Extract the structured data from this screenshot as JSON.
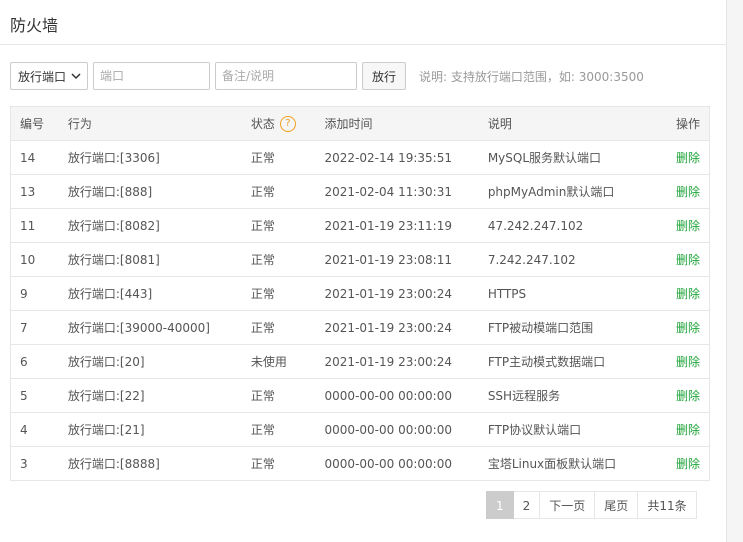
{
  "page": {
    "title": "防火墙"
  },
  "toolbar": {
    "select_value": "放行端口",
    "port_placeholder": "端口",
    "note_placeholder": "备注/说明",
    "submit_label": "放行",
    "hint": "说明: 支持放行端口范围，如: 3000:3500"
  },
  "table": {
    "headers": [
      "编号",
      "行为",
      "状态",
      "添加时间",
      "说明",
      "操作"
    ],
    "help_icon": "?",
    "rows": [
      {
        "id": "14",
        "action": "放行端口:[3306]",
        "status": "正常",
        "time": "2022-02-14 19:35:51",
        "note": "MySQL服务默认端口",
        "op": "删除"
      },
      {
        "id": "13",
        "action": "放行端口:[888]",
        "status": "正常",
        "time": "2021-02-04 11:30:31",
        "note": "phpMyAdmin默认端口",
        "op": "删除"
      },
      {
        "id": "11",
        "action": "放行端口:[8082]",
        "status": "正常",
        "time": "2021-01-19 23:11:19",
        "note": "47.242.247.102",
        "op": "删除"
      },
      {
        "id": "10",
        "action": "放行端口:[8081]",
        "status": "正常",
        "time": "2021-01-19 23:08:11",
        "note": "7.242.247.102",
        "op": "删除"
      },
      {
        "id": "9",
        "action": "放行端口:[443]",
        "status": "正常",
        "time": "2021-01-19 23:00:24",
        "note": "HTTPS",
        "op": "删除"
      },
      {
        "id": "7",
        "action": "放行端口:[39000-40000]",
        "status": "正常",
        "time": "2021-01-19 23:00:24",
        "note": "FTP被动模端口范围",
        "op": "删除"
      },
      {
        "id": "6",
        "action": "放行端口:[20]",
        "status": "未使用",
        "time": "2021-01-19 23:00:24",
        "note": "FTP主动模式数据端口",
        "op": "删除"
      },
      {
        "id": "5",
        "action": "放行端口:[22]",
        "status": "正常",
        "time": "0000-00-00 00:00:00",
        "note": "SSH远程服务",
        "op": "删除"
      },
      {
        "id": "4",
        "action": "放行端口:[21]",
        "status": "正常",
        "time": "0000-00-00 00:00:00",
        "note": "FTP协议默认端口",
        "op": "删除"
      },
      {
        "id": "3",
        "action": "放行端口:[8888]",
        "status": "正常",
        "time": "0000-00-00 00:00:00",
        "note": "宝塔Linux面板默认端口",
        "op": "删除"
      }
    ]
  },
  "pagination": {
    "pages": [
      "1",
      "2"
    ],
    "current": "1",
    "next": "下一页",
    "last": "尾页",
    "total": "共11条"
  },
  "colors": {
    "delete_link": "#20a53a",
    "help_icon": "#f0a020"
  },
  "icons": {
    "select_arrow": "chevron-down-icon",
    "status_help": "question-circle-icon"
  }
}
